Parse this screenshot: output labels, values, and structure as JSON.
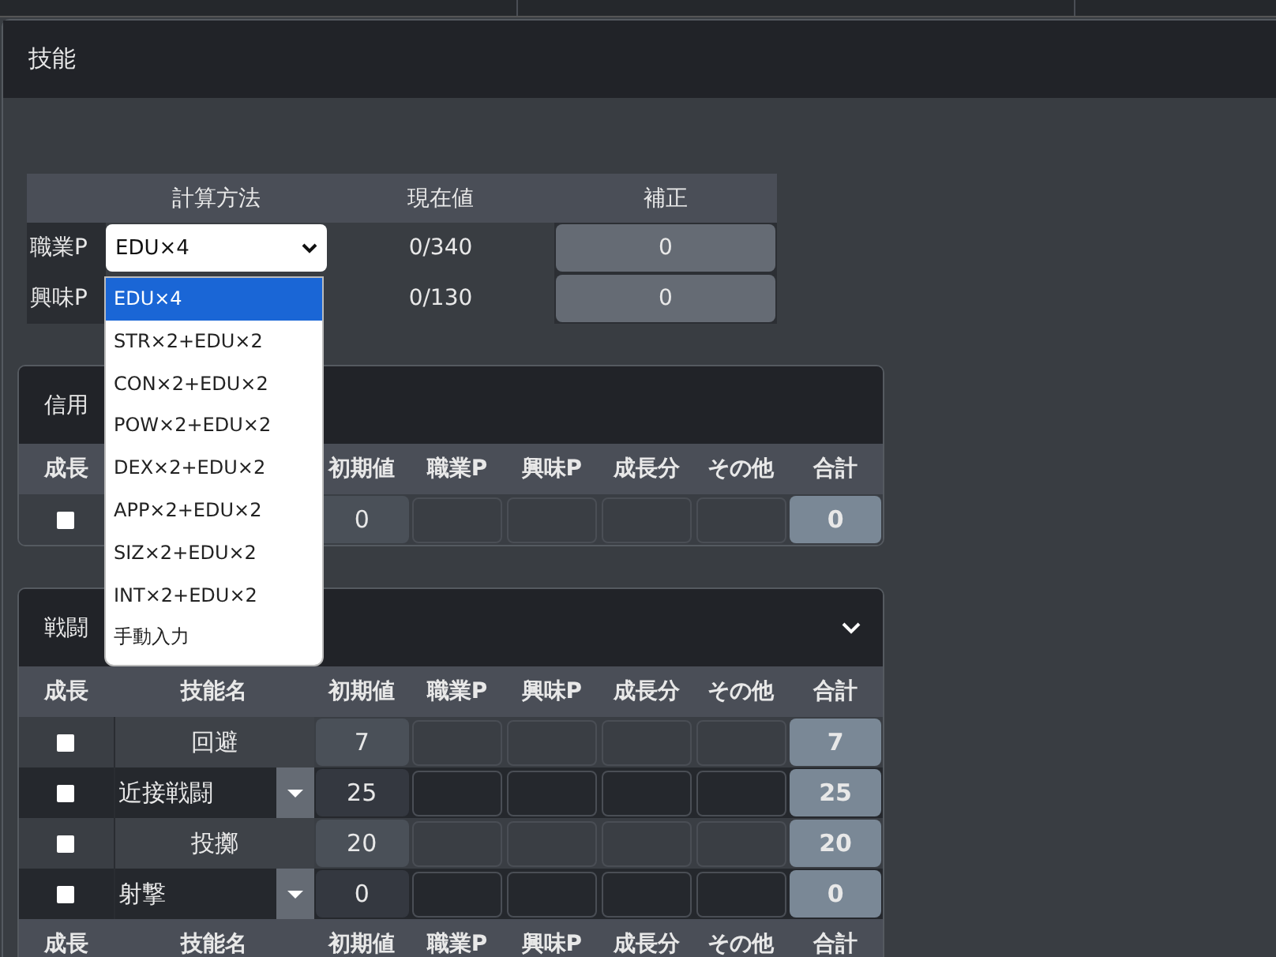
{
  "section": {
    "title": "技能"
  },
  "points": {
    "columns": [
      "計算方法",
      "現在値",
      "補正"
    ],
    "rows": [
      {
        "label": "職業P",
        "method": "EDU×4",
        "current": "0/340",
        "bonus": "0"
      },
      {
        "label": "興味P",
        "current": "0/130",
        "bonus": "0"
      }
    ]
  },
  "method_menu": {
    "options": [
      {
        "label": "EDU×4",
        "selected": true
      },
      {
        "label": "STR×2+EDU×2",
        "selected": false
      },
      {
        "label": "CON×2+EDU×2",
        "selected": false
      },
      {
        "label": "POW×2+EDU×2",
        "selected": false
      },
      {
        "label": "DEX×2+EDU×2",
        "selected": false
      },
      {
        "label": "APP×2+EDU×2",
        "selected": false
      },
      {
        "label": "SIZ×2+EDU×2",
        "selected": false
      },
      {
        "label": "INT×2+EDU×2",
        "selected": false
      },
      {
        "label": "手動入力",
        "selected": false
      }
    ]
  },
  "groups": [
    {
      "title": "信用",
      "collapsible": false,
      "columns": [
        "成長",
        "",
        "初期値",
        "職業P",
        "興味P",
        "成長分",
        "その他",
        "合計"
      ],
      "rows": [
        {
          "kind": "plain",
          "checked": false,
          "base": "0",
          "total": "0"
        }
      ]
    },
    {
      "title": "戦闘",
      "collapsible": true,
      "columns": [
        "成長",
        "技能名",
        "初期値",
        "職業P",
        "興味P",
        "成長分",
        "その他",
        "合計"
      ],
      "rows": [
        {
          "kind": "plain",
          "name": "回避",
          "checked": false,
          "base": "7",
          "total": "7"
        },
        {
          "kind": "select",
          "name": "近接戦闘",
          "checked": false,
          "base": "25",
          "total": "25"
        },
        {
          "kind": "plain",
          "name": "投擲",
          "checked": false,
          "base": "20",
          "total": "20"
        },
        {
          "kind": "select",
          "name": "射撃",
          "checked": false,
          "base": "0",
          "total": "0"
        }
      ],
      "footer_columns": [
        "成長",
        "技能名",
        "初期値",
        "職業P",
        "興味P",
        "成長分",
        "その他",
        "合計"
      ]
    }
  ]
}
